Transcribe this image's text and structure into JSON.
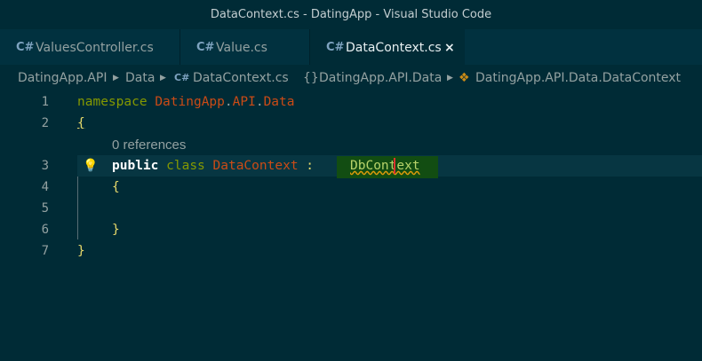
{
  "window": {
    "title": "DataContext.cs - DatingApp - Visual Studio Code"
  },
  "tabs": [
    {
      "label": "ValuesController.cs",
      "icon": "csharp-file-icon",
      "active": false
    },
    {
      "label": "Value.cs",
      "icon": "csharp-file-icon",
      "active": false
    },
    {
      "label": "DataContext.cs",
      "icon": "csharp-file-icon",
      "active": true,
      "close_glyph": "×"
    }
  ],
  "breadcrumb": {
    "items": [
      "DatingApp.API",
      "Data",
      "DataContext.cs",
      "DatingApp.API.Data",
      "DatingApp.API.Data.DataContext"
    ],
    "namespace_glyph": "{}",
    "class_icon": "class-symbol-icon"
  },
  "editor": {
    "line_numbers": [
      "1",
      "2",
      "3",
      "4",
      "5",
      "6",
      "7"
    ],
    "codelens": "0 references",
    "line1": {
      "keyword": "namespace",
      "ns1": "DatingApp",
      "dot1": ".",
      "ns2": "API",
      "dot2": ".",
      "ns3": "Data"
    },
    "line2": {
      "brace": "{"
    },
    "line3": {
      "public": "public",
      "class": "class",
      "name": "DataContext",
      "colon": ":",
      "base": "DbContext"
    },
    "line4": {
      "brace": "{"
    },
    "line6": {
      "brace": "}"
    },
    "line7": {
      "brace": "}"
    },
    "lightbulb_icon": "lightbulb-icon",
    "colors": {
      "background": "#002b36",
      "keyword": "#859900",
      "identifier": "#cb4b16",
      "highlight": "#124d12",
      "squiggle": "#e09b0b"
    }
  }
}
